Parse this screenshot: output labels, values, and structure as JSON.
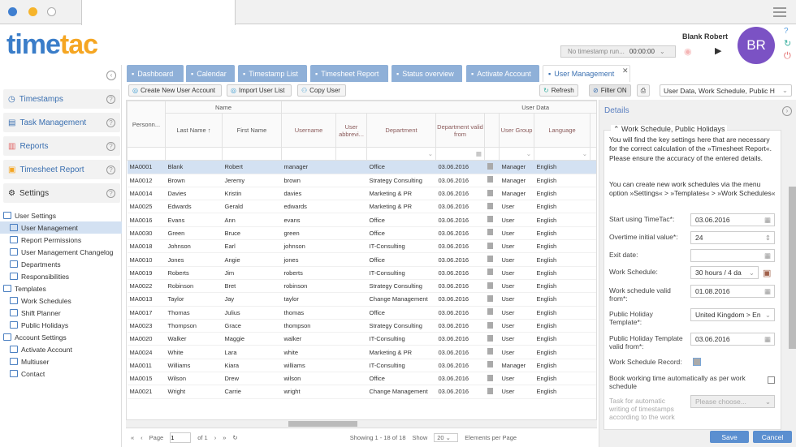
{
  "logo": {
    "part1": "time",
    "part2": "tac"
  },
  "user": {
    "name": "Blank Robert",
    "initials": "BR",
    "timestamp_status": "No timestamp run...",
    "timer": "00:00:00"
  },
  "sidebar": {
    "nav": [
      {
        "label": "Timestamps"
      },
      {
        "label": "Task Management"
      },
      {
        "label": "Reports"
      },
      {
        "label": "Timesheet Report"
      },
      {
        "label": "Settings"
      }
    ],
    "tree": [
      {
        "label": "User Settings",
        "level": 0
      },
      {
        "label": "User Management",
        "level": 1,
        "selected": true
      },
      {
        "label": "Report Permissions",
        "level": 1
      },
      {
        "label": "User Management Changelog",
        "level": 1
      },
      {
        "label": "Departments",
        "level": 1
      },
      {
        "label": "Responsibilities",
        "level": 1
      },
      {
        "label": "Templates",
        "level": 0
      },
      {
        "label": "Work Schedules",
        "level": 1
      },
      {
        "label": "Shift Planner",
        "level": 1
      },
      {
        "label": "Public Holidays",
        "level": 1
      },
      {
        "label": "Account Settings",
        "level": 0
      },
      {
        "label": "Activate Account",
        "level": 1
      },
      {
        "label": "Multiuser",
        "level": 1
      },
      {
        "label": "Contact",
        "level": 1
      }
    ]
  },
  "tabs": [
    "Dashboard",
    "Calendar",
    "Timestamp List",
    "Timesheet Report",
    "Status overview",
    "Activate Account",
    "User Management"
  ],
  "toolbar": {
    "create": "Create New User Account",
    "import": "Import User List",
    "copy": "Copy User",
    "refresh": "Refresh",
    "filter": "Filter ON",
    "view": "User Data, Work Schedule, Public H"
  },
  "grid": {
    "group_name": "Name",
    "group_user": "User Data",
    "columns": [
      "Personn...",
      "Last Name ↑",
      "First Name",
      "Username",
      "User abbrevi...",
      "Department",
      "Department valid from",
      "",
      "User Group",
      "Language"
    ],
    "rows": [
      [
        "MA0001",
        "Blank",
        "Robert",
        "manager",
        "Office",
        "03.06.2016",
        "Manager",
        "English"
      ],
      [
        "MA0012",
        "Brown",
        "Jeremy",
        "brown",
        "Strategy Consulting",
        "03.06.2016",
        "Manager",
        "English"
      ],
      [
        "MA0014",
        "Davies",
        "Kristin",
        "davies",
        "Marketing & PR",
        "03.06.2016",
        "Manager",
        "English"
      ],
      [
        "MA0025",
        "Edwards",
        "Gerald",
        "edwards",
        "Marketing & PR",
        "03.06.2016",
        "User",
        "English"
      ],
      [
        "MA0016",
        "Evans",
        "Ann",
        "evans",
        "Office",
        "03.06.2016",
        "User",
        "English"
      ],
      [
        "MA0030",
        "Green",
        "Bruce",
        "green",
        "Office",
        "03.06.2016",
        "User",
        "English"
      ],
      [
        "MA0018",
        "Johnson",
        "Earl",
        "johnson",
        "IT-Consulting",
        "03.06.2016",
        "User",
        "English"
      ],
      [
        "MA0010",
        "Jones",
        "Angie",
        "jones",
        "Office",
        "03.06.2016",
        "User",
        "English"
      ],
      [
        "MA0019",
        "Roberts",
        "Jim",
        "roberts",
        "IT-Consulting",
        "03.06.2016",
        "User",
        "English"
      ],
      [
        "MA0022",
        "Robinson",
        "Bret",
        "robinson",
        "Strategy Consulting",
        "03.06.2016",
        "User",
        "English"
      ],
      [
        "MA0013",
        "Taylor",
        "Jay",
        "taylor",
        "Change Management",
        "03.06.2016",
        "User",
        "English"
      ],
      [
        "MA0017",
        "Thomas",
        "Julius",
        "thomas",
        "Office",
        "03.06.2016",
        "User",
        "English"
      ],
      [
        "MA0023",
        "Thompson",
        "Grace",
        "thompson",
        "Strategy Consulting",
        "03.06.2016",
        "User",
        "English"
      ],
      [
        "MA0020",
        "Walker",
        "Maggie",
        "walker",
        "IT-Consulting",
        "03.06.2016",
        "User",
        "English"
      ],
      [
        "MA0024",
        "White",
        "Lara",
        "white",
        "Marketing & PR",
        "03.06.2016",
        "User",
        "English"
      ],
      [
        "MA0011",
        "Williams",
        "Kiara",
        "williams",
        "IT-Consulting",
        "03.06.2016",
        "Manager",
        "English"
      ],
      [
        "MA0015",
        "Wilson",
        "Drew",
        "wilson",
        "Office",
        "03.06.2016",
        "User",
        "English"
      ],
      [
        "MA0021",
        "Wright",
        "Carrie",
        "wright",
        "Change Management",
        "03.06.2016",
        "User",
        "English"
      ]
    ]
  },
  "pager": {
    "page": "Page",
    "page_value": "1",
    "of": "of 1",
    "showing": "Showing 1 - 18 of 18",
    "show": "Show",
    "per_page": "20",
    "elements": "Elements per Page"
  },
  "details": {
    "title": "Details",
    "section": "Work Schedule, Public Holidays",
    "intro1": "You will find the key settings here that are necessary for the correct calculation of the »Timesheet Report«. Please ensure the accuracy of the entered details.",
    "intro2": "You can create new work schedules via the menu option »Settings« > »Templates« > »Work Schedules«",
    "fields": [
      {
        "label": "Start using TimeTac*:",
        "value": "03.06.2016"
      },
      {
        "label": "Overtime initial value*:",
        "value": "24"
      },
      {
        "label": "Exit date:",
        "value": ""
      },
      {
        "label": "Work Schedule:",
        "value": "30 hours / 4 da"
      },
      {
        "label": "Work schedule valid from*:",
        "value": "01.08.2016"
      },
      {
        "label": "Public Holiday Template*:",
        "value": "United Kingdom > En"
      },
      {
        "label": "Public Holiday Template valid from*:",
        "value": "03.06.2016"
      },
      {
        "label": "Work Schedule Record:",
        "value": ""
      },
      {
        "label": "Book working time automatically as per work schedule",
        "value": ""
      },
      {
        "label": "Task for automatic writing of timestamps according to the work",
        "value": "Please choose..."
      }
    ],
    "save": "Save",
    "cancel": "Cancel"
  },
  "colors": {
    "accent": "#3a6fb0",
    "tab": "#8fb0d8",
    "avatar": "#7b52c4",
    "logo_orange": "#f5a623"
  }
}
